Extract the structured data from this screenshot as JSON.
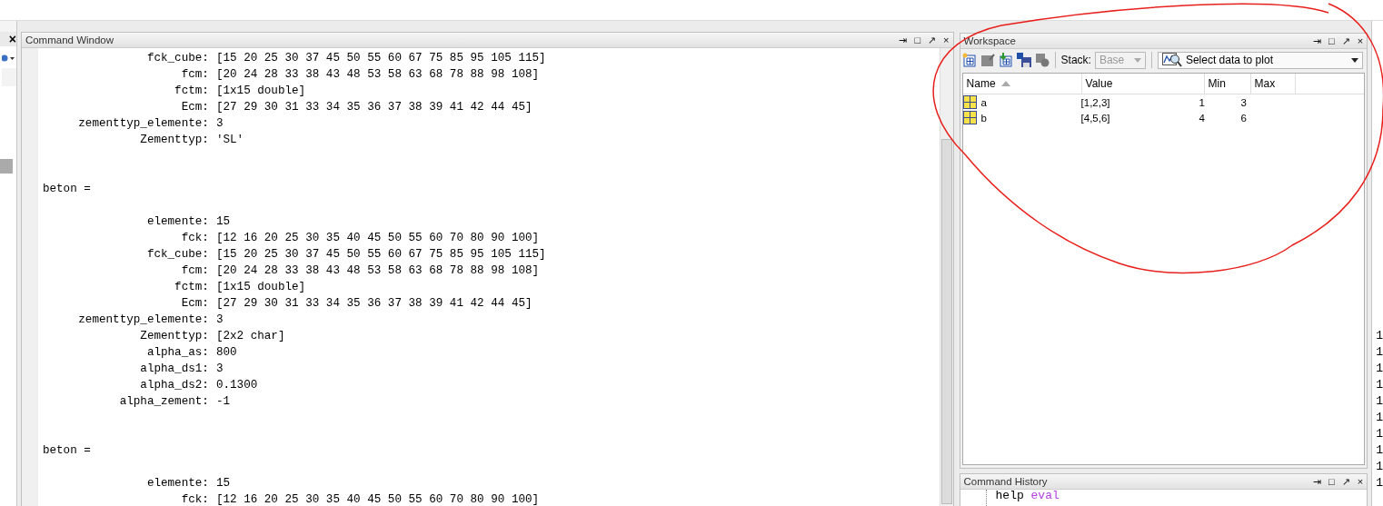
{
  "left_panel": {
    "close": "×"
  },
  "command_window": {
    "title": "Command Window",
    "controls": [
      "⇥",
      "□",
      "↗",
      "×"
    ],
    "lines": [
      {
        "kind": "field",
        "label": "fck_cube:",
        "value": "[15 20 25 30 37 45 50 55 60 67 75 85 95 105 115]"
      },
      {
        "kind": "field",
        "label": "fcm:",
        "value": "[20 24 28 33 38 43 48 53 58 63 68 78 88 98 108]"
      },
      {
        "kind": "field",
        "label": "fctm:",
        "value": "[1x15 double]"
      },
      {
        "kind": "field",
        "label": "Ecm:",
        "value": "[27 29 30 31 33 34 35 36 37 38 39 41 42 44 45]"
      },
      {
        "kind": "field",
        "label": "zementtyp_elemente:",
        "value": "3"
      },
      {
        "kind": "field",
        "label": "Zementtyp:",
        "value": "'SL'"
      },
      {
        "kind": "blank"
      },
      {
        "kind": "blank"
      },
      {
        "kind": "name",
        "label": "beton ="
      },
      {
        "kind": "blank"
      },
      {
        "kind": "field",
        "label": "elemente:",
        "value": "15"
      },
      {
        "kind": "field",
        "label": "fck:",
        "value": "[12 16 20 25 30 35 40 45 50 55 60 70 80 90 100]"
      },
      {
        "kind": "field",
        "label": "fck_cube:",
        "value": "[15 20 25 30 37 45 50 55 60 67 75 85 95 105 115]"
      },
      {
        "kind": "field",
        "label": "fcm:",
        "value": "[20 24 28 33 38 43 48 53 58 63 68 78 88 98 108]"
      },
      {
        "kind": "field",
        "label": "fctm:",
        "value": "[1x15 double]"
      },
      {
        "kind": "field",
        "label": "Ecm:",
        "value": "[27 29 30 31 33 34 35 36 37 38 39 41 42 44 45]"
      },
      {
        "kind": "field",
        "label": "zementtyp_elemente:",
        "value": "3"
      },
      {
        "kind": "field",
        "label": "Zementtyp:",
        "value": "[2x2 char]"
      },
      {
        "kind": "field",
        "label": "alpha_as:",
        "value": "800"
      },
      {
        "kind": "field",
        "label": "alpha_ds1:",
        "value": "3"
      },
      {
        "kind": "field",
        "label": "alpha_ds2:",
        "value": "0.1300"
      },
      {
        "kind": "field",
        "label": "alpha_zement:",
        "value": "-1"
      },
      {
        "kind": "blank"
      },
      {
        "kind": "blank"
      },
      {
        "kind": "name",
        "label": "beton ="
      },
      {
        "kind": "blank"
      },
      {
        "kind": "field",
        "label": "elemente:",
        "value": "15"
      },
      {
        "kind": "field",
        "label": "fck:",
        "value": "[12 16 20 25 30 35 40 45 50 55 60 70 80 90 100]"
      }
    ]
  },
  "workspace": {
    "title": "Workspace",
    "controls": [
      "⇥",
      "□",
      "↗",
      "×"
    ],
    "toolbar": {
      "stack_label": "Stack:",
      "stack": {
        "value": "Base",
        "disabled": true
      },
      "plot": {
        "value": "Select data to plot"
      }
    },
    "table": {
      "columns": [
        {
          "label": "Name",
          "sorted": true
        },
        {
          "label": "Value",
          "sorted": false
        },
        {
          "label": "Min",
          "sorted": false
        },
        {
          "label": "Max",
          "sorted": false
        }
      ],
      "rows": [
        [
          "a",
          "[1,2,3]",
          "1",
          "3"
        ],
        [
          "b",
          "[4,5,6]",
          "4",
          "6"
        ]
      ]
    }
  },
  "command_history": {
    "title": "Command History",
    "controls": [
      "⇥",
      "□",
      "↗",
      "×"
    ],
    "entry": {
      "command": "help",
      "argument": "eval"
    }
  },
  "right_panel": {
    "digits": [
      "1",
      "1",
      "1",
      "1",
      "1",
      "1",
      "1",
      "1",
      "1",
      "1"
    ]
  }
}
